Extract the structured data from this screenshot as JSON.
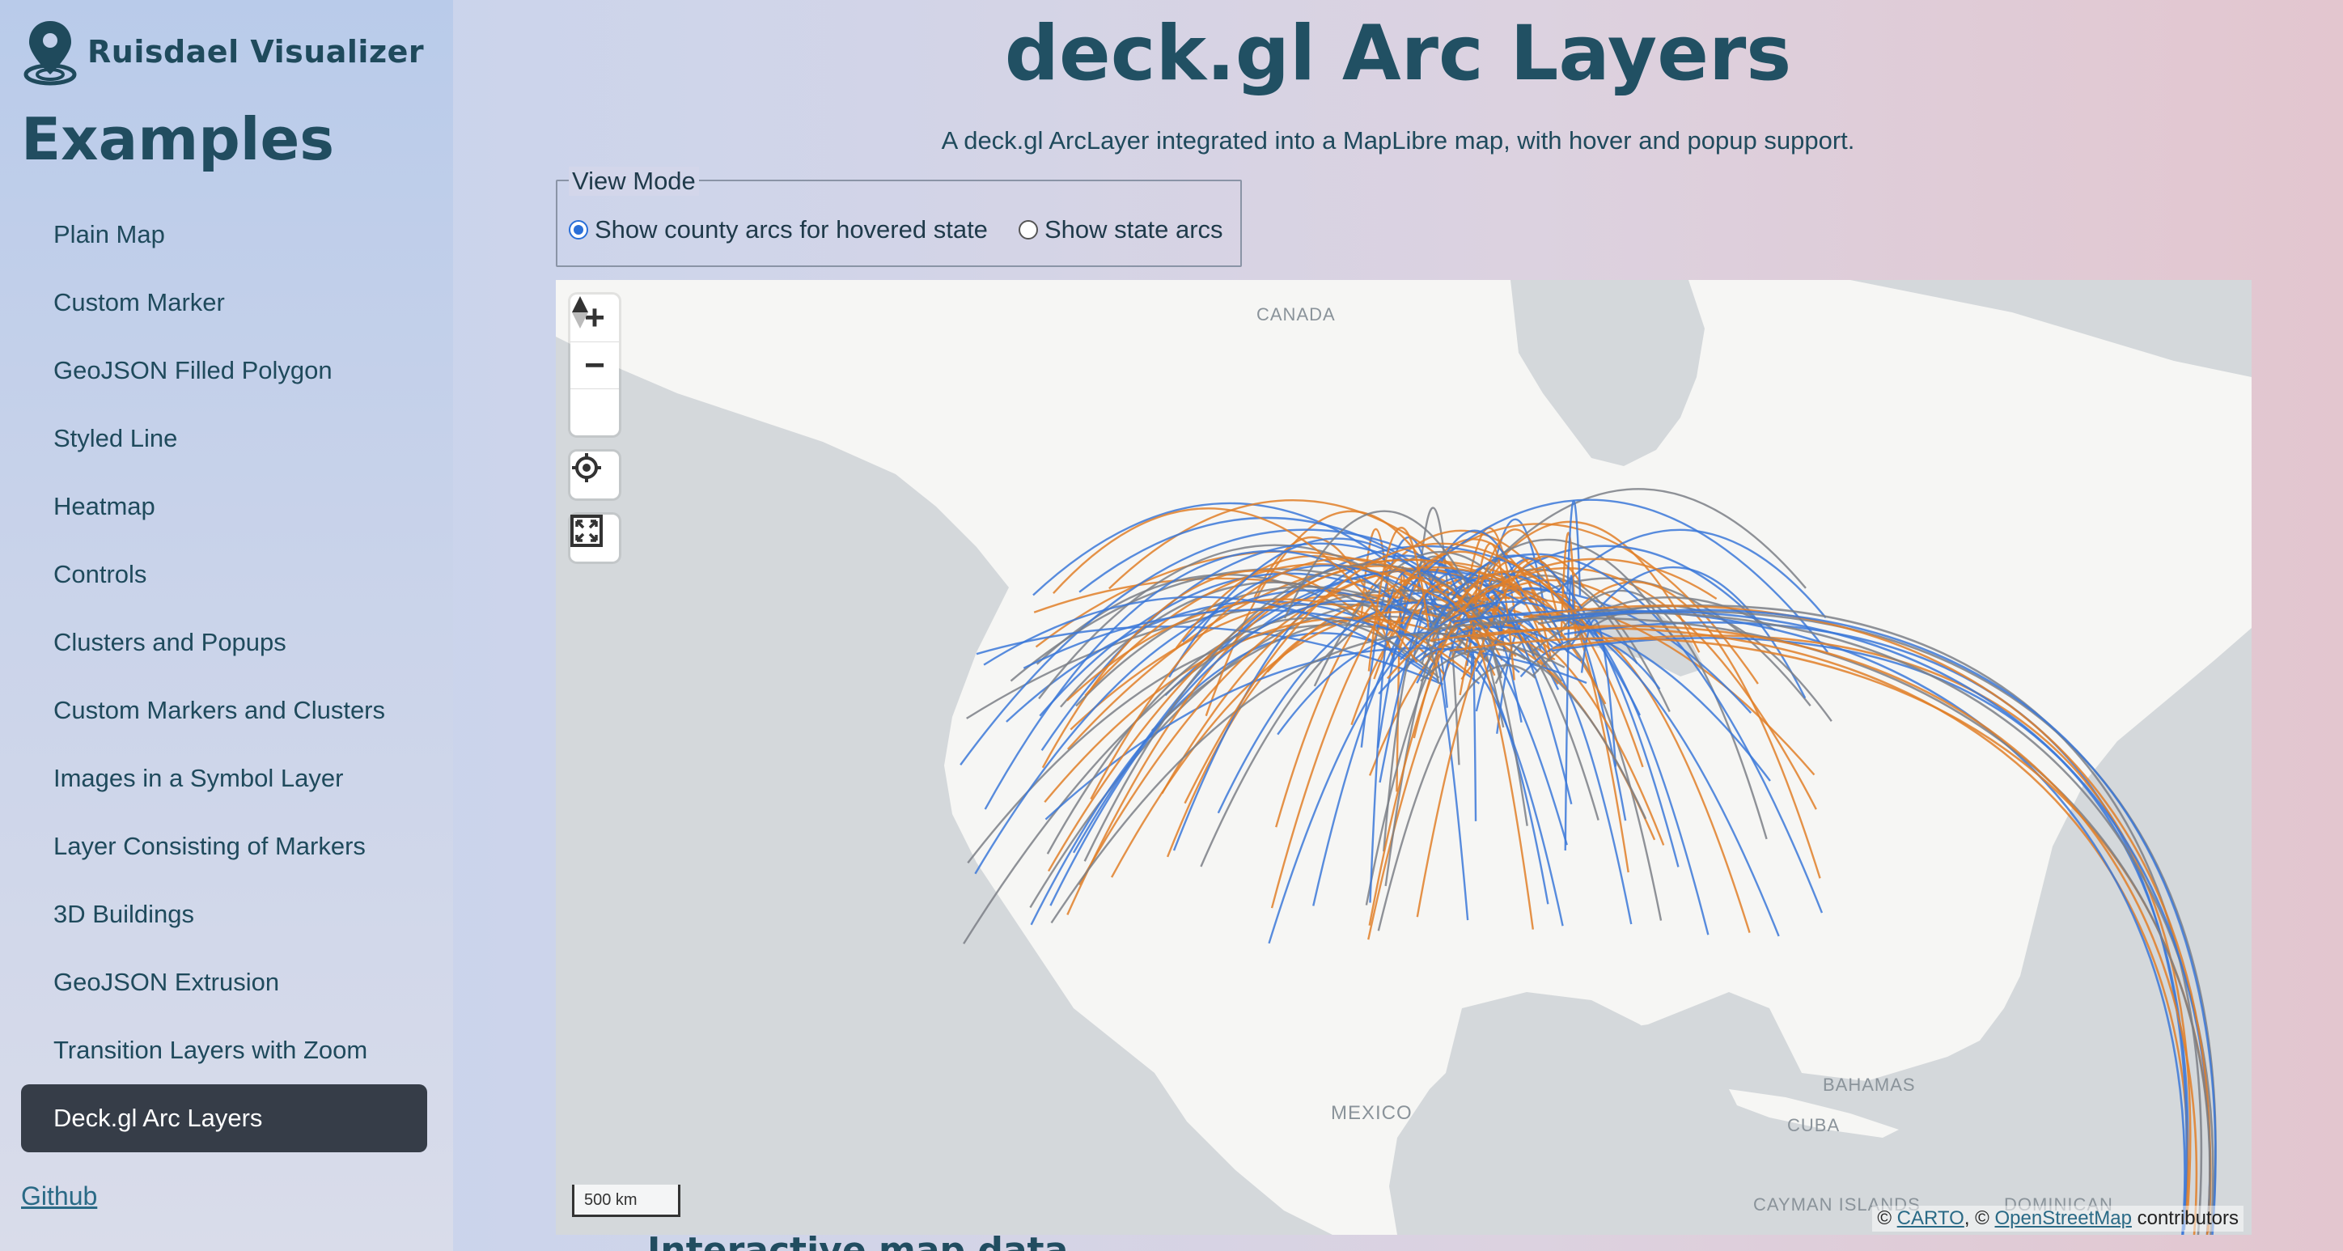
{
  "brand": {
    "name": "Ruisdael Visualizer",
    "logo_icon": "map-pin-logo-icon"
  },
  "sidebar": {
    "heading": "Examples",
    "items": [
      {
        "label": "Plain Map"
      },
      {
        "label": "Custom Marker"
      },
      {
        "label": "GeoJSON Filled Polygon"
      },
      {
        "label": "Styled Line"
      },
      {
        "label": "Heatmap"
      },
      {
        "label": "Controls"
      },
      {
        "label": "Clusters and Popups"
      },
      {
        "label": "Custom Markers and Clusters"
      },
      {
        "label": "Images in a Symbol Layer"
      },
      {
        "label": "Layer Consisting of Markers"
      },
      {
        "label": "3D Buildings"
      },
      {
        "label": "GeoJSON Extrusion"
      },
      {
        "label": "Transition Layers with Zoom"
      },
      {
        "label": "Deck.gl Arc Layers",
        "active": true
      }
    ],
    "github": "Github"
  },
  "main": {
    "title": "deck.gl Arc Layers",
    "subtitle": "A deck.gl ArcLayer integrated into a MapLibre map, with hover and popup support.",
    "view_mode": {
      "legend": "View Mode",
      "options": [
        {
          "label": "Show county arcs for hovered state",
          "checked": true
        },
        {
          "label": "Show state arcs",
          "checked": false
        }
      ]
    },
    "below_map_heading": "Interactive map data"
  },
  "map": {
    "controls": {
      "zoom_in": "+",
      "zoom_out": "−",
      "compass_icon": "compass-icon",
      "geolocate_icon": "geolocate-icon",
      "fullscreen_icon": "fullscreen-icon"
    },
    "labels": {
      "canada": "CANADA",
      "mexico": "MEXICO",
      "bahamas": "BAHAMAS",
      "cuba": "CUBA",
      "cayman": "CAYMAN ISLANDS",
      "dominican": "DOMINICAN"
    },
    "scale": "500 km",
    "attribution": {
      "prefix": "© ",
      "carto": "CARTO",
      "mid": ", © ",
      "osm": "OpenStreetMap",
      "suffix": " contributors"
    },
    "colors": {
      "arc_blue": "#3b78d8",
      "arc_orange": "#e07f28",
      "arc_gray": "#7b7f86",
      "land": "#f6f6f4",
      "water": "#d4d8db"
    }
  }
}
